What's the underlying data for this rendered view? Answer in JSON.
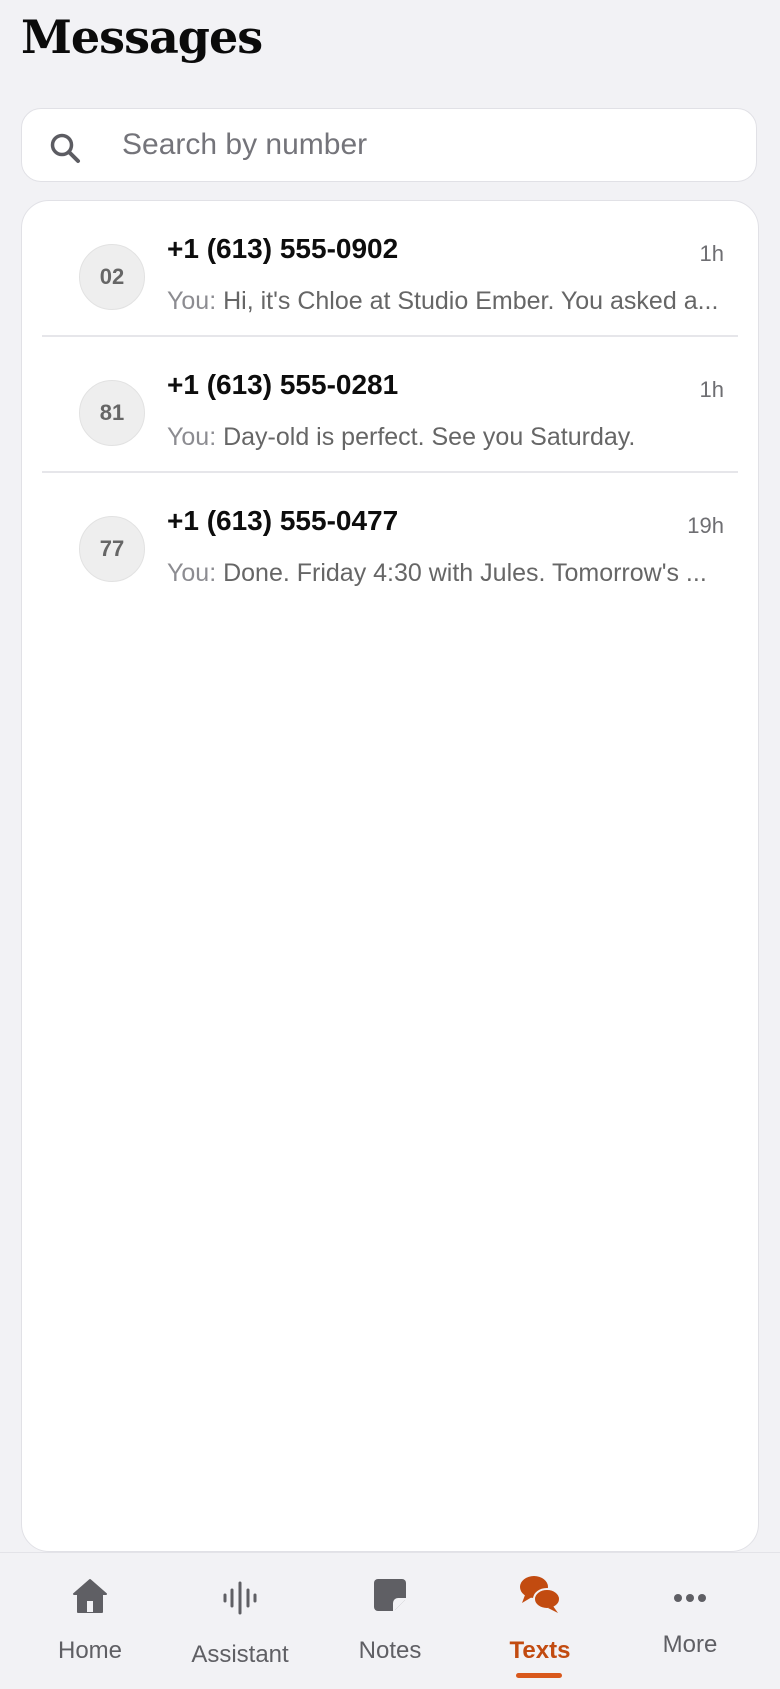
{
  "header": {
    "title": "Messages"
  },
  "search": {
    "placeholder": "Search by number",
    "value": ""
  },
  "conversations": [
    {
      "avatar": "02",
      "phone": "+1 (613) 555-0902",
      "time": "1h",
      "sender": "You:",
      "preview": "Hi, it's Chloe at Studio Ember. You asked a..."
    },
    {
      "avatar": "81",
      "phone": "+1 (613) 555-0281",
      "time": "1h",
      "sender": "You:",
      "preview": "Day-old is perfect. See you Saturday."
    },
    {
      "avatar": "77",
      "phone": "+1 (613) 555-0477",
      "time": "19h",
      "sender": "You:",
      "preview": "Done. Friday 4:30 with Jules. Tomorrow's ..."
    }
  ],
  "tabs": [
    {
      "label": "Home",
      "icon": "home-icon",
      "active": false
    },
    {
      "label": "Assistant",
      "icon": "waveform-icon",
      "active": false
    },
    {
      "label": "Notes",
      "icon": "note-icon",
      "active": false
    },
    {
      "label": "Texts",
      "icon": "chat-bubbles-icon",
      "active": true
    },
    {
      "label": "More",
      "icon": "more-dots-icon",
      "active": false
    }
  ],
  "colors": {
    "accent": "#c24b10",
    "indicator": "#d9581c",
    "background": "#f2f2f5"
  }
}
